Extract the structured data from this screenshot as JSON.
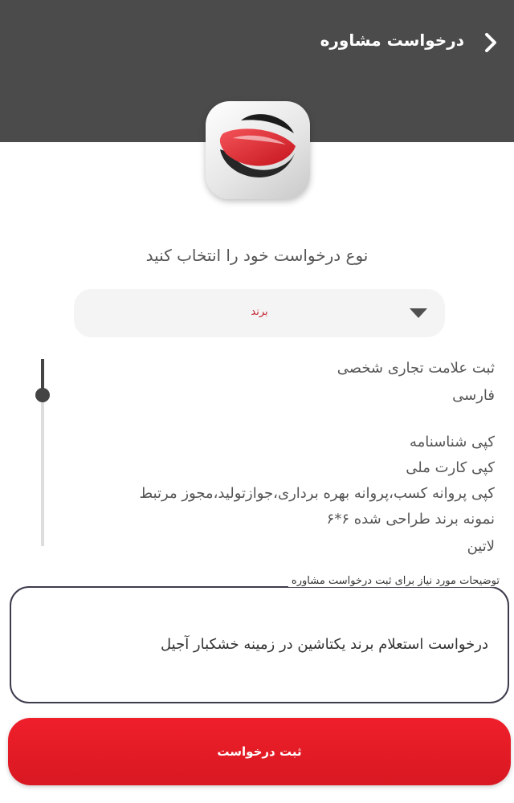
{
  "header": {
    "title": "درخواست مشاوره",
    "back_icon": "chevron-right-icon"
  },
  "logo": {
    "icon": "brand-logo-icon",
    "colors": [
      "#e21f26",
      "#1b1b1b",
      "#ffffff"
    ]
  },
  "form": {
    "prompt": "نوع درخواست خود را انتخاب کنید",
    "request_type": {
      "selected": "برند"
    },
    "info_lines": [
      "ثبت علامت تجاری شخصی",
      "فارسی",
      "کپی شناسنامه",
      "کپی کارت ملی",
      "کپی پروانه کسب،پروانه بهره برداری،جوازتولید،مجوز مرتبط",
      "نمونه برند طراحی شده ۶*۶",
      "لاتین"
    ],
    "description": {
      "label": "توضیحات مورد نیاز برای ثبت درخواست مشاوره",
      "value": "درخواست استعلام برند یکتاشین در زمینه خشکبار آجیل"
    },
    "submit_label": "ثبت درخواست"
  },
  "colors": {
    "header_bg": "#4b4b4b",
    "accent": "#e21f26"
  }
}
